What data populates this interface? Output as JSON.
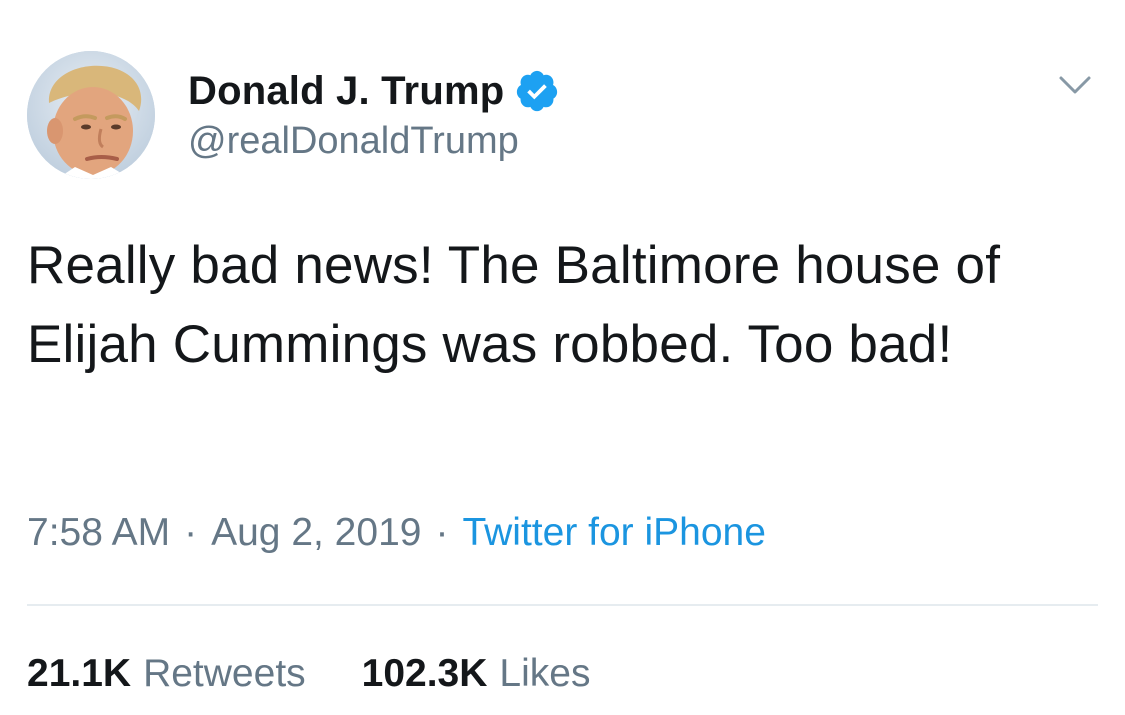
{
  "author": {
    "display_name": "Donald J. Trump",
    "handle": "@realDonaldTrump",
    "verified": true,
    "avatar_icon": "profile-photo"
  },
  "tweet": {
    "text": "Really bad news! The Baltimore house of Elijah Cummings was robbed. Too bad!"
  },
  "meta": {
    "time": "7:58 AM",
    "separator": "·",
    "date": "Aug 2, 2019",
    "source": "Twitter for iPhone"
  },
  "stats": {
    "retweets_count": "21.1K",
    "retweets_label": "Retweets",
    "likes_count": "102.3K",
    "likes_label": "Likes"
  },
  "colors": {
    "text_primary": "#14171a",
    "text_secondary": "#657786",
    "link_blue": "#1b95e0",
    "verified_blue": "#1da1f2",
    "divider": "#e6ecf0"
  }
}
